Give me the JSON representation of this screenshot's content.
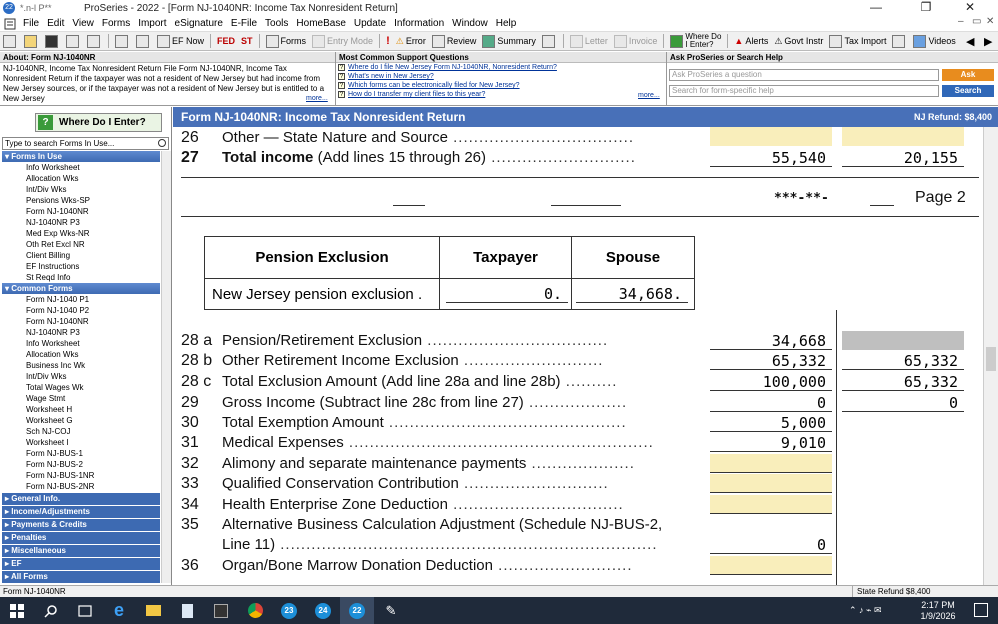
{
  "window": {
    "brand": "*.n-l P**",
    "title": "ProSeries - 2022 - [Form NJ-1040NR: Income Tax Nonresident Return]",
    "app_badge": "22",
    "minimize": "—",
    "restore": "❐",
    "close": "✕",
    "mdi_min": "–",
    "mdi_restore": "▭",
    "mdi_close": "✕"
  },
  "menu": [
    "File",
    "Edit",
    "View",
    "Forms",
    "Import",
    "eSignature",
    "E-File",
    "Tools",
    "HomeBase",
    "Update",
    "Information",
    "Window",
    "Help"
  ],
  "toolbar": {
    "ef_now": "EF Now",
    "fed": "FED",
    "st": "ST",
    "forms": "Forms",
    "entry_mode": "Entry Mode",
    "error": "Error",
    "review": "Review",
    "summary": "Summary",
    "letter": "Letter",
    "invoice": "Invoice",
    "where_do_i_enter": "Where Do I Enter?",
    "alerts": "Alerts",
    "govt_instr": "Govt Instr",
    "tax_import": "Tax Import",
    "videos": "Videos",
    "where_line1": "Where Do",
    "where_line2": "I Enter?"
  },
  "about": {
    "heading": "About: Form NJ-1040NR",
    "text": "NJ-1040NR, Income Tax Nonresident Return File Form NJ-1040NR, Income Tax Nonresident Return if the taxpayer was not a resident of New Jersey but had income from New Jersey sources, or if the taxpayer was not a resident of New Jersey but is entitled to a New Jersey",
    "more": "more..."
  },
  "support": {
    "heading": "Most Common Support Questions",
    "questions": [
      "Where do I file New Jersey Form NJ-1040NR, Nonresident Return?",
      "What's new in New Jersey?",
      "Which forms can be electronically filed for New Jersey?",
      "How do I transfer my client files to this year?"
    ],
    "more": "more..."
  },
  "ask": {
    "heading": "Ask ProSeries or Search Help",
    "ask_placeholder": "Ask ProSeries a question",
    "ask_button": "Ask",
    "search_placeholder": "Search for form-specific help",
    "search_button": "Search"
  },
  "sidebar": {
    "where_button": "Where Do I Enter?",
    "search_placeholder": "Type to search Forms In Use...",
    "forms_in_use_label": "Forms In Use",
    "forms_in_use": [
      "Info Worksheet",
      "Allocation Wks",
      "Int/Div Wks",
      "Pensions Wks-SP",
      "Form NJ-1040NR",
      "NJ-1040NR P3",
      "Med Exp Wks-NR",
      "Oth Ret Excl NR",
      "Client Billing",
      "EF Instructions",
      "St Reqd Info"
    ],
    "common_forms_label": "Common Forms",
    "common_forms": [
      "Form NJ-1040 P1",
      "Form NJ-1040 P2",
      "Form NJ-1040NR",
      "NJ-1040NR P3",
      "Info Worksheet",
      "Allocation Wks",
      "Business Inc Wk",
      "Int/Div Wks",
      "Total Wages Wk",
      "Wage Stmt",
      "Worksheet H",
      "Worksheet G",
      "Sch NJ-COJ",
      "Worksheet I",
      "Form NJ-BUS-1",
      "Form NJ-BUS-2",
      "Form NJ-BUS-1NR",
      "Form NJ-BUS-2NR"
    ],
    "groups": [
      "General Info.",
      "Income/Adjustments",
      "Payments & Credits",
      "Penalties",
      "Miscellaneous",
      "EF",
      "All Forms"
    ]
  },
  "form_header": {
    "title": "Form NJ-1040NR: Income Tax Nonresident Return",
    "refund": "NJ Refund: $8,400"
  },
  "form": {
    "line26": {
      "num": "26",
      "label": "Other — State Nature and Source"
    },
    "line27": {
      "num": "27",
      "label_bold": "Total income",
      "label": " (Add lines 15 through 26)",
      "col1": "55,540",
      "col2": "20,155"
    },
    "page_ref": {
      "ssn_mask": "***-**-",
      "page": "Page 2"
    },
    "pension": {
      "header": "Pension Exclusion",
      "taxpayer": "Taxpayer",
      "spouse": "Spouse",
      "row_label": "New Jersey pension exclusion",
      "taxpayer_val": "0.",
      "spouse_val": "34,668."
    },
    "lines": [
      {
        "num": "28 a",
        "label": "Pension/Retirement Exclusion",
        "col1": "34,668",
        "col2": ""
      },
      {
        "num": "28 b",
        "label": "Other Retirement Income Exclusion",
        "col1": "65,332",
        "col2": "65,332"
      },
      {
        "num": "28 c",
        "label": "Total Exclusion Amount (Add line 28a and line 28b)",
        "col1": "100,000",
        "col2": "65,332"
      },
      {
        "num": "29",
        "label": "Gross Income (Subtract line 28c from line 27)",
        "col1": "0",
        "col2": "0"
      },
      {
        "num": "30",
        "label": "Total Exemption Amount",
        "col1": "5,000",
        "col2": ""
      },
      {
        "num": "31",
        "label": "Medical Expenses",
        "col1": "9,010",
        "col2": ""
      },
      {
        "num": "32",
        "label": "Alimony and separate maintenance payments",
        "col1": "",
        "col2": ""
      },
      {
        "num": "33",
        "label": "Qualified Conservation Contribution",
        "col1": "",
        "col2": ""
      },
      {
        "num": "34",
        "label": "Health Enterprise Zone Deduction",
        "col1": "",
        "col2": ""
      },
      {
        "num": "35",
        "label": "Alternative Business Calculation Adjustment (Schedule NJ-BUS-2,",
        "label2": "Line 11)",
        "col1": "0",
        "col2": ""
      },
      {
        "num": "36",
        "label": "Organ/Bone Marrow Donation Deduction",
        "col1": "",
        "col2": ""
      }
    ]
  },
  "status": {
    "left": "Form NJ-1040NR",
    "right": "State Refund $8,400"
  },
  "taskbar": {
    "badges": [
      "23",
      "24",
      "22"
    ],
    "time": "2:17 PM",
    "date": "1/9/2026"
  }
}
